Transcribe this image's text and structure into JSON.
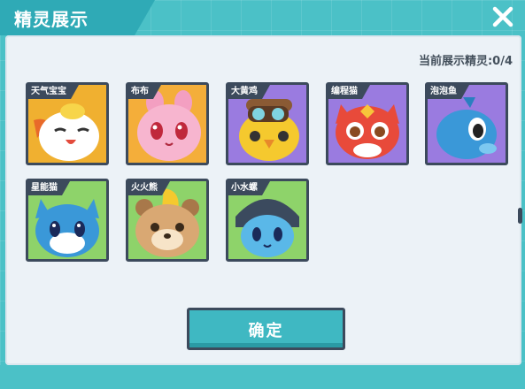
{
  "header": {
    "title": "精灵展示"
  },
  "counter": {
    "text": "当前展示精灵:0/4"
  },
  "cards": [
    {
      "label": "天气宝宝",
      "bg": "#f0b030",
      "creature": "white-egg-sprite-icon"
    },
    {
      "label": "布布",
      "bg": "#f4ae3a",
      "creature": "pink-blob-sprite-icon"
    },
    {
      "label": "大黄鸡",
      "bg": "#9a7be0",
      "creature": "yellow-chick-goggles-sprite-icon"
    },
    {
      "label": "编程猫",
      "bg": "#9a7be0",
      "creature": "red-cat-sprite-icon"
    },
    {
      "label": "泡泡鱼",
      "bg": "#9a7be0",
      "creature": "blue-fish-sprite-icon"
    },
    {
      "label": "星能猫",
      "bg": "#8ed36a",
      "creature": "blue-cat-sprite-icon"
    },
    {
      "label": "火火熊",
      "bg": "#8ed36a",
      "creature": "bear-sprite-icon"
    },
    {
      "label": "小水螺",
      "bg": "#8ed36a",
      "creature": "blue-snail-sprite-icon"
    }
  ],
  "footer": {
    "confirm_label": "确定"
  },
  "colors": {
    "accent": "#3fb8c2",
    "dark": "#3c4a5c",
    "panel": "#ecf2f7"
  }
}
